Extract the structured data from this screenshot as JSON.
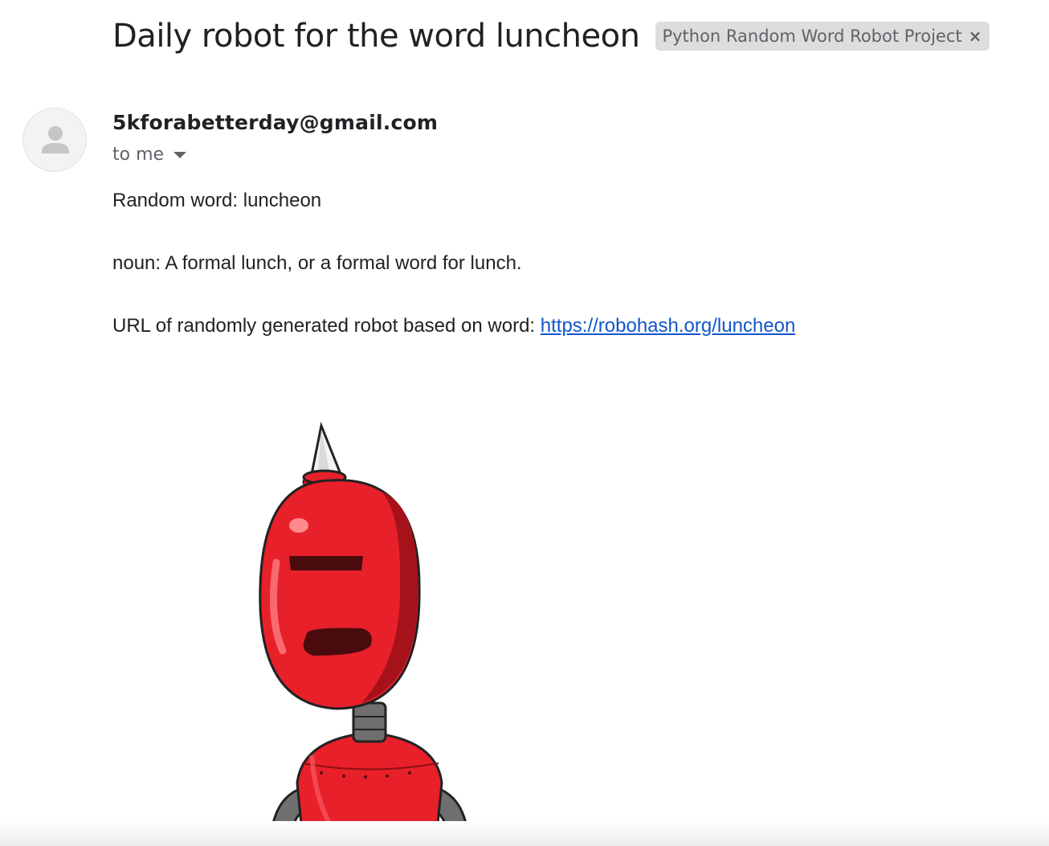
{
  "email": {
    "subject": "Daily robot for the word luncheon",
    "label": "Python Random Word Robot Project",
    "label_close": "×",
    "sender": "5kforabetterday@gmail.com",
    "recipient": "to me",
    "body": {
      "line1": "Random word: luncheon",
      "line2": "noun: A formal lunch, or a formal word for lunch.",
      "line3_prefix": "URL of randomly generated robot based on word: ",
      "link_text": "https://robohash.org/luncheon"
    }
  },
  "icons": {
    "avatar": "person-avatar-icon",
    "dropdown": "chevron-down-icon",
    "robot_image": "red-robot-image"
  },
  "colors": {
    "link": "#1155cc",
    "robot_red": "#e8202a",
    "label_bg": "#dddddd"
  }
}
